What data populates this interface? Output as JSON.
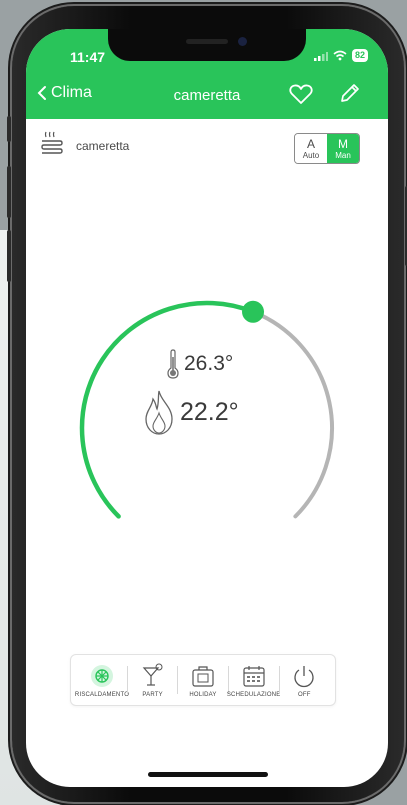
{
  "status": {
    "time": "11:47",
    "battery": "82"
  },
  "nav": {
    "back_label": "Clima",
    "title": "cameretta"
  },
  "room": {
    "name": "cameretta"
  },
  "mode_toggle": {
    "auto_letter": "A",
    "auto_label": "Auto",
    "man_letter": "M",
    "man_label": "Man",
    "selected": "Man"
  },
  "thermostat": {
    "current_temp": "26.3°",
    "set_temp": "22.2°",
    "set_level": 0.58
  },
  "modes": [
    {
      "label": "RISCALDAMENTO",
      "icon": "sun-icon",
      "active": true
    },
    {
      "label": "PARTY",
      "icon": "cocktail-icon",
      "active": false
    },
    {
      "label": "HOLIDAY",
      "icon": "suitcase-icon",
      "active": false
    },
    {
      "label": "SCHEDULAZIONE",
      "icon": "calendar-icon",
      "active": false
    },
    {
      "label": "OFF",
      "icon": "power-icon",
      "active": false
    }
  ],
  "colors": {
    "accent": "#29c45a",
    "track": "#b5b5b5",
    "text": "#3a3a3a"
  }
}
